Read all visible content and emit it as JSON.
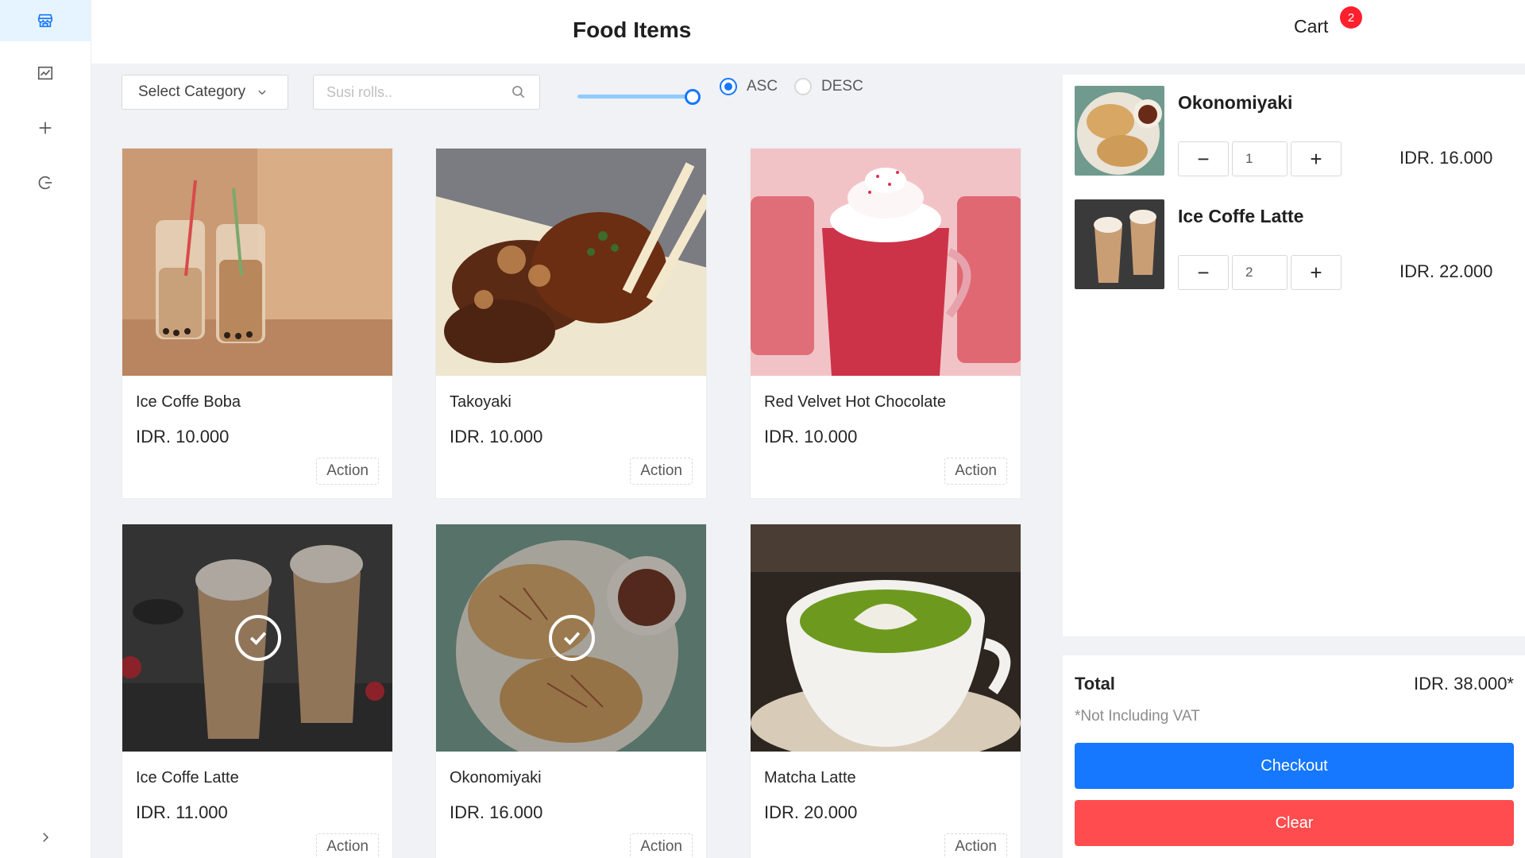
{
  "sidebar": {
    "items": [
      {
        "icon": "store-icon",
        "active": true
      },
      {
        "icon": "line-chart-icon",
        "active": false
      },
      {
        "icon": "plus-icon",
        "active": false
      },
      {
        "icon": "logout-icon",
        "active": false
      }
    ],
    "collapse_icon": "chevron-right-icon"
  },
  "header": {
    "title": "Food Items",
    "cart_label": "Cart",
    "cart_count": "2"
  },
  "toolbar": {
    "category_label": "Select Category",
    "search_placeholder": "Susi rolls..",
    "search_value": "",
    "slider_value_percent": 100,
    "sort_options": [
      {
        "label": "ASC",
        "checked": true
      },
      {
        "label": "DESC",
        "checked": false
      }
    ]
  },
  "products": [
    {
      "name": "Ice Coffe Boba",
      "price": "IDR. 10.000",
      "action": "Action",
      "selected": false
    },
    {
      "name": "Takoyaki",
      "price": "IDR. 10.000",
      "action": "Action",
      "selected": false
    },
    {
      "name": "Red Velvet Hot Chocolate",
      "price": "IDR. 10.000",
      "action": "Action",
      "selected": false
    },
    {
      "name": "Ice Coffe Latte",
      "price": "IDR. 11.000",
      "action": "Action",
      "selected": true
    },
    {
      "name": "Okonomiyaki",
      "price": "IDR. 16.000",
      "action": "Action",
      "selected": true
    },
    {
      "name": "Matcha Latte",
      "price": "IDR. 20.000",
      "action": "Action",
      "selected": false
    }
  ],
  "cart": {
    "items": [
      {
        "name": "Okonomiyaki",
        "qty": "1",
        "price": "IDR. 16.000"
      },
      {
        "name": "Ice Coffe Latte",
        "qty": "2",
        "price": "IDR. 22.000"
      }
    ],
    "total_label": "Total",
    "total_value": "IDR. 38.000*",
    "vat_note": "*Not Including VAT",
    "checkout_label": "Checkout",
    "clear_label": "Clear"
  },
  "colors": {
    "primary": "#1677ff",
    "danger": "#ff4d4f",
    "badge": "#ff1f2d"
  }
}
